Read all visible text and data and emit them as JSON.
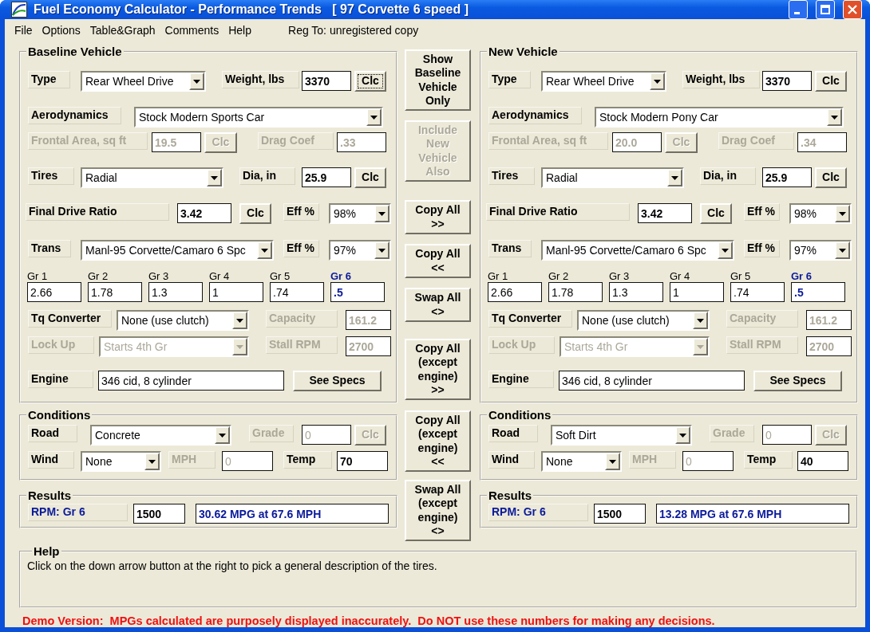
{
  "window": {
    "title": "Fuel Economy Calculator - Performance Trends   [ 97 Corvette 6 speed ]"
  },
  "menu": [
    {
      "label": "File"
    },
    {
      "label": "Options"
    },
    {
      "label": "Table&Graph"
    },
    {
      "label": "Comments"
    },
    {
      "label": "Help"
    }
  ],
  "registration": "Reg To: unregistered copy",
  "sides": [
    {
      "sections": [
        {
          "title": "Baseline Vehicle",
          "rows": [
            {
              "kind": "controls",
              "items": [
                {
                  "kind": "label",
                  "text": "Type",
                  "disabled": false
                },
                {
                  "kind": "combo",
                  "value": "Rear Wheel Drive",
                  "disabled": false
                },
                {
                  "kind": "label",
                  "text": "Weight, lbs",
                  "disabled": false
                },
                {
                  "kind": "value-field",
                  "value": "3370",
                  "disabled": false
                },
                {
                  "kind": "button",
                  "text": "Clc",
                  "disabled": false,
                  "focused": true
                }
              ]
            },
            {
              "kind": "controls",
              "items": [
                {
                  "kind": "label",
                  "text": "Aerodynamics",
                  "disabled": false
                },
                {
                  "kind": "combo",
                  "value": "Stock Modern Sports Car",
                  "disabled": false
                }
              ]
            },
            {
              "kind": "controls",
              "items": [
                {
                  "kind": "label",
                  "text": "Frontal Area, sq ft",
                  "disabled": true
                },
                {
                  "kind": "value-field",
                  "value": "19.5",
                  "disabled": true
                },
                {
                  "kind": "button",
                  "text": "Clc",
                  "disabled": true,
                  "focused": false
                },
                {
                  "kind": "label",
                  "text": "Drag Coef",
                  "disabled": true
                },
                {
                  "kind": "value-field",
                  "value": ".33",
                  "disabled": true
                }
              ]
            },
            {
              "kind": "controls",
              "items": [
                {
                  "kind": "label",
                  "text": "Tires",
                  "disabled": false
                },
                {
                  "kind": "combo",
                  "value": "Radial",
                  "disabled": false
                },
                {
                  "kind": "label",
                  "text": "Dia, in",
                  "disabled": false
                },
                {
                  "kind": "value-field",
                  "value": "25.9",
                  "disabled": false
                },
                {
                  "kind": "button",
                  "text": "Clc",
                  "disabled": false,
                  "focused": false
                }
              ]
            },
            {
              "kind": "controls",
              "items": [
                {
                  "kind": "label",
                  "text": "Final Drive Ratio",
                  "disabled": false
                },
                {
                  "kind": "value-field",
                  "value": "3.42",
                  "disabled": false
                },
                {
                  "kind": "button",
                  "text": "Clc",
                  "disabled": false,
                  "focused": false
                },
                {
                  "kind": "label",
                  "text": "Eff %",
                  "disabled": false
                },
                {
                  "kind": "combo",
                  "value": "98%",
                  "disabled": false
                }
              ]
            },
            {
              "kind": "controls",
              "items": [
                {
                  "kind": "label",
                  "text": "Trans",
                  "disabled": false
                },
                {
                  "kind": "combo",
                  "value": "Manl-95 Corvette/Camaro 6 Spc",
                  "disabled": false
                },
                {
                  "kind": "label",
                  "text": "Eff %",
                  "disabled": false
                },
                {
                  "kind": "combo",
                  "value": "97%",
                  "disabled": false
                }
              ]
            },
            {
              "kind": "gears",
              "gears": [
                {
                  "label": "Gr 1",
                  "value": "2.66",
                  "selected": false
                },
                {
                  "label": "Gr 2",
                  "value": "1.78",
                  "selected": false
                },
                {
                  "label": "Gr 3",
                  "value": "1.3",
                  "selected": false
                },
                {
                  "label": "Gr 4",
                  "value": "1",
                  "selected": false
                },
                {
                  "label": "Gr 5",
                  "value": ".74",
                  "selected": false
                },
                {
                  "label": "Gr 6",
                  "value": ".5",
                  "selected": true
                }
              ]
            },
            {
              "kind": "controls",
              "items": [
                {
                  "kind": "label",
                  "text": "Tq Converter",
                  "disabled": false
                },
                {
                  "kind": "combo",
                  "value": "None (use clutch)",
                  "disabled": false
                },
                {
                  "kind": "label",
                  "text": "Capacity",
                  "disabled": true
                },
                {
                  "kind": "value-field",
                  "value": "161.2",
                  "disabled": true
                }
              ]
            },
            {
              "kind": "controls",
              "items": [
                {
                  "kind": "label",
                  "text": "Lock Up",
                  "disabled": true
                },
                {
                  "kind": "combo",
                  "value": "Starts 4th Gr",
                  "disabled": true
                },
                {
                  "kind": "label",
                  "text": "Stall RPM",
                  "disabled": true
                },
                {
                  "kind": "value-field",
                  "value": "2700",
                  "disabled": true
                }
              ]
            },
            {
              "kind": "controls",
              "items": [
                {
                  "kind": "label",
                  "text": "Engine",
                  "disabled": false
                },
                {
                  "kind": "text-field",
                  "value": "346 cid, 8 cylinder",
                  "disabled": false
                },
                {
                  "kind": "button",
                  "text": "See Specs",
                  "disabled": false,
                  "focused": false
                }
              ]
            }
          ]
        },
        {
          "title": "Conditions",
          "rows": [
            {
              "kind": "controls",
              "items": [
                {
                  "kind": "label",
                  "text": "Road",
                  "disabled": false
                },
                {
                  "kind": "combo",
                  "value": "Concrete",
                  "disabled": false
                },
                {
                  "kind": "label",
                  "text": "Grade",
                  "disabled": true
                },
                {
                  "kind": "text-field",
                  "value": "0",
                  "disabled": true
                },
                {
                  "kind": "button",
                  "text": "Clc",
                  "disabled": true,
                  "focused": false
                }
              ]
            },
            {
              "kind": "controls",
              "items": [
                {
                  "kind": "label",
                  "text": "Wind",
                  "disabled": false
                },
                {
                  "kind": "combo",
                  "value": "None",
                  "disabled": false
                },
                {
                  "kind": "label",
                  "text": "MPH",
                  "disabled": true
                },
                {
                  "kind": "text-field",
                  "value": "0",
                  "disabled": true
                },
                {
                  "kind": "label",
                  "text": "Temp",
                  "disabled": false
                },
                {
                  "kind": "value-field",
                  "value": "70",
                  "disabled": false
                }
              ]
            }
          ]
        },
        {
          "title": "Results",
          "rows": [
            {
              "kind": "controls",
              "items": [
                {
                  "kind": "result-label",
                  "text": "RPM: Gr 6",
                  "disabled": false
                },
                {
                  "kind": "value-field",
                  "value": "1500",
                  "disabled": false
                },
                {
                  "kind": "result-field",
                  "value": "30.62 MPG at 67.6 MPH",
                  "disabled": false
                }
              ]
            }
          ]
        }
      ]
    },
    {
      "sections": [
        {
          "title": "New Vehicle",
          "rows": [
            {
              "kind": "controls",
              "items": [
                {
                  "kind": "label",
                  "text": "Type",
                  "disabled": false
                },
                {
                  "kind": "combo",
                  "value": "Rear Wheel Drive",
                  "disabled": false
                },
                {
                  "kind": "label",
                  "text": "Weight, lbs",
                  "disabled": false
                },
                {
                  "kind": "value-field",
                  "value": "3370",
                  "disabled": false
                },
                {
                  "kind": "button",
                  "text": "Clc",
                  "disabled": false,
                  "focused": false
                }
              ]
            },
            {
              "kind": "controls",
              "items": [
                {
                  "kind": "label",
                  "text": "Aerodynamics",
                  "disabled": false
                },
                {
                  "kind": "combo",
                  "value": "Stock Modern Pony Car",
                  "disabled": false
                }
              ]
            },
            {
              "kind": "controls",
              "items": [
                {
                  "kind": "label",
                  "text": "Frontal Area, sq ft",
                  "disabled": true
                },
                {
                  "kind": "value-field",
                  "value": "20.0",
                  "disabled": true
                },
                {
                  "kind": "button",
                  "text": "Clc",
                  "disabled": true,
                  "focused": false
                },
                {
                  "kind": "label",
                  "text": "Drag Coef",
                  "disabled": true
                },
                {
                  "kind": "value-field",
                  "value": ".34",
                  "disabled": true
                }
              ]
            },
            {
              "kind": "controls",
              "items": [
                {
                  "kind": "label",
                  "text": "Tires",
                  "disabled": false
                },
                {
                  "kind": "combo",
                  "value": "Radial",
                  "disabled": false
                },
                {
                  "kind": "label",
                  "text": "Dia, in",
                  "disabled": false
                },
                {
                  "kind": "value-field",
                  "value": "25.9",
                  "disabled": false
                },
                {
                  "kind": "button",
                  "text": "Clc",
                  "disabled": false,
                  "focused": false
                }
              ]
            },
            {
              "kind": "controls",
              "items": [
                {
                  "kind": "label",
                  "text": "Final Drive Ratio",
                  "disabled": false
                },
                {
                  "kind": "value-field",
                  "value": "3.42",
                  "disabled": false
                },
                {
                  "kind": "button",
                  "text": "Clc",
                  "disabled": false,
                  "focused": false
                },
                {
                  "kind": "label",
                  "text": "Eff %",
                  "disabled": false
                },
                {
                  "kind": "combo",
                  "value": "98%",
                  "disabled": false
                }
              ]
            },
            {
              "kind": "controls",
              "items": [
                {
                  "kind": "label",
                  "text": "Trans",
                  "disabled": false
                },
                {
                  "kind": "combo",
                  "value": "Manl-95 Corvette/Camaro 6 Spc",
                  "disabled": false
                },
                {
                  "kind": "label",
                  "text": "Eff %",
                  "disabled": false
                },
                {
                  "kind": "combo",
                  "value": "97%",
                  "disabled": false
                }
              ]
            },
            {
              "kind": "gears",
              "gears": [
                {
                  "label": "Gr 1",
                  "value": "2.66",
                  "selected": false
                },
                {
                  "label": "Gr 2",
                  "value": "1.78",
                  "selected": false
                },
                {
                  "label": "Gr 3",
                  "value": "1.3",
                  "selected": false
                },
                {
                  "label": "Gr 4",
                  "value": "1",
                  "selected": false
                },
                {
                  "label": "Gr 5",
                  "value": ".74",
                  "selected": false
                },
                {
                  "label": "Gr 6",
                  "value": ".5",
                  "selected": true
                }
              ]
            },
            {
              "kind": "controls",
              "items": [
                {
                  "kind": "label",
                  "text": "Tq Converter",
                  "disabled": false
                },
                {
                  "kind": "combo",
                  "value": "None (use clutch)",
                  "disabled": false
                },
                {
                  "kind": "label",
                  "text": "Capacity",
                  "disabled": true
                },
                {
                  "kind": "value-field",
                  "value": "161.2",
                  "disabled": true
                }
              ]
            },
            {
              "kind": "controls",
              "items": [
                {
                  "kind": "label",
                  "text": "Lock Up",
                  "disabled": true
                },
                {
                  "kind": "combo",
                  "value": "Starts 4th Gr",
                  "disabled": true
                },
                {
                  "kind": "label",
                  "text": "Stall RPM",
                  "disabled": true
                },
                {
                  "kind": "value-field",
                  "value": "2700",
                  "disabled": true
                }
              ]
            },
            {
              "kind": "controls",
              "items": [
                {
                  "kind": "label",
                  "text": "Engine",
                  "disabled": false
                },
                {
                  "kind": "text-field",
                  "value": "346 cid, 8 cylinder",
                  "disabled": false
                },
                {
                  "kind": "button",
                  "text": "See Specs",
                  "disabled": false,
                  "focused": false
                }
              ]
            }
          ]
        },
        {
          "title": "Conditions",
          "rows": [
            {
              "kind": "controls",
              "items": [
                {
                  "kind": "label",
                  "text": "Road",
                  "disabled": false
                },
                {
                  "kind": "combo",
                  "value": "Soft Dirt",
                  "disabled": false
                },
                {
                  "kind": "label",
                  "text": "Grade",
                  "disabled": true
                },
                {
                  "kind": "text-field",
                  "value": "0",
                  "disabled": true
                },
                {
                  "kind": "button",
                  "text": "Clc",
                  "disabled": true,
                  "focused": false
                }
              ]
            },
            {
              "kind": "controls",
              "items": [
                {
                  "kind": "label",
                  "text": "Wind",
                  "disabled": false
                },
                {
                  "kind": "combo",
                  "value": "None",
                  "disabled": false
                },
                {
                  "kind": "label",
                  "text": "MPH",
                  "disabled": true
                },
                {
                  "kind": "text-field",
                  "value": "0",
                  "disabled": true
                },
                {
                  "kind": "label",
                  "text": "Temp",
                  "disabled": false
                },
                {
                  "kind": "value-field",
                  "value": "40",
                  "disabled": false
                }
              ]
            }
          ]
        },
        {
          "title": "Results",
          "rows": [
            {
              "kind": "controls",
              "items": [
                {
                  "kind": "result-label",
                  "text": "RPM: Gr 6",
                  "disabled": false
                },
                {
                  "kind": "value-field",
                  "value": "1500",
                  "disabled": false
                },
                {
                  "kind": "result-field",
                  "value": "13.28 MPG at 67.6 MPH",
                  "disabled": false
                }
              ]
            }
          ]
        }
      ]
    }
  ],
  "center_buttons": [
    {
      "lines": [
        "Show",
        "Baseline",
        "Vehicle",
        "Only"
      ],
      "disabled": false
    },
    {
      "lines": [
        "Include",
        "New",
        "Vehicle",
        "Also"
      ],
      "disabled": true
    },
    {
      "lines": [
        "Copy All",
        ">>"
      ],
      "disabled": false
    },
    {
      "lines": [
        "Copy All",
        "<<"
      ],
      "disabled": false
    },
    {
      "lines": [
        "Swap All",
        "<>"
      ],
      "disabled": false
    },
    {
      "lines": [
        "Copy All",
        "(except",
        "engine)",
        ">>"
      ],
      "disabled": false
    },
    {
      "lines": [
        "Copy All",
        "(except",
        "engine)",
        "<<"
      ],
      "disabled": false
    },
    {
      "lines": [
        "Swap All",
        "(except",
        "engine)",
        "<>"
      ],
      "disabled": false
    }
  ],
  "help": {
    "title": "Help",
    "text": "Click on the down arrow button at the right to pick a general description of the tires."
  },
  "demo_notice": "Demo Version:  MPGs calculated are purposely displayed inaccurately.  Do NOT use these numbers for making any decisions."
}
